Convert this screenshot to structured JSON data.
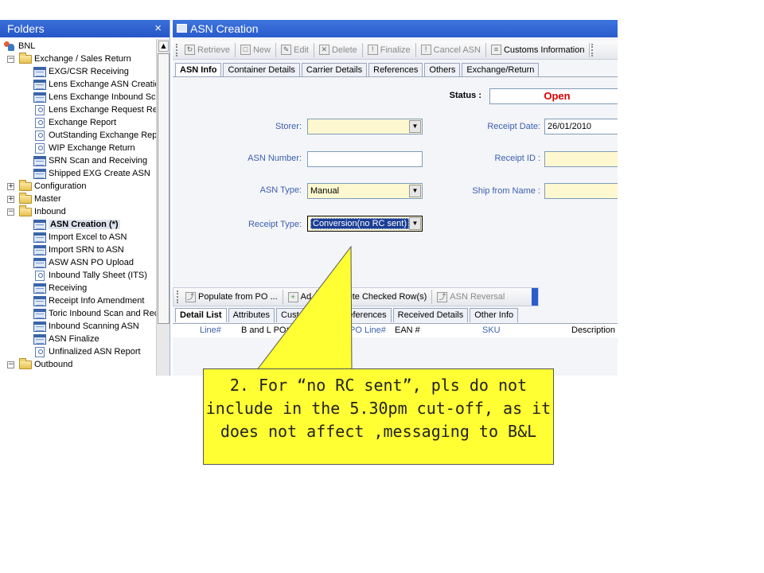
{
  "folders": {
    "title": "Folders",
    "close_glyph": "×",
    "items": [
      {
        "label": "BNL",
        "icon": "people-icon",
        "indent": 0,
        "expander": ""
      },
      {
        "label": "Exchange / Sales Return",
        "icon": "folder-icon",
        "indent": 1,
        "expander": "−"
      },
      {
        "label": "EXG/CSR Receiving",
        "icon": "screen-icon",
        "indent": 2,
        "expander": ""
      },
      {
        "label": "Lens Exchange ASN Creatic",
        "icon": "screen-icon",
        "indent": 2,
        "expander": ""
      },
      {
        "label": "Lens Exchange Inbound Sca",
        "icon": "screen-icon",
        "indent": 2,
        "expander": ""
      },
      {
        "label": "Lens Exchange Request Re",
        "icon": "report-icon",
        "indent": 2,
        "expander": ""
      },
      {
        "label": "Exchange Report",
        "icon": "report-icon",
        "indent": 2,
        "expander": ""
      },
      {
        "label": "OutStanding Exchange Rep",
        "icon": "report-icon",
        "indent": 2,
        "expander": ""
      },
      {
        "label": "WIP Exchange Return",
        "icon": "report-icon",
        "indent": 2,
        "expander": ""
      },
      {
        "label": "SRN Scan and Receiving",
        "icon": "screen-icon",
        "indent": 2,
        "expander": ""
      },
      {
        "label": "Shipped EXG Create ASN",
        "icon": "screen-icon",
        "indent": 2,
        "expander": ""
      },
      {
        "label": "Configuration",
        "icon": "folder-icon",
        "indent": 1,
        "expander": "+"
      },
      {
        "label": "Master",
        "icon": "folder-icon",
        "indent": 1,
        "expander": "+"
      },
      {
        "label": "Inbound",
        "icon": "folder-icon",
        "indent": 1,
        "expander": "−"
      },
      {
        "label": "ASN Creation (*)",
        "icon": "screen-icon",
        "indent": 2,
        "expander": "",
        "selected": true
      },
      {
        "label": "Import Excel to ASN",
        "icon": "screen-icon",
        "indent": 2,
        "expander": ""
      },
      {
        "label": "Import SRN to ASN",
        "icon": "screen-icon",
        "indent": 2,
        "expander": ""
      },
      {
        "label": "ASW ASN PO Upload",
        "icon": "screen-icon",
        "indent": 2,
        "expander": ""
      },
      {
        "label": "Inbound Tally Sheet (ITS)",
        "icon": "report-icon",
        "indent": 2,
        "expander": ""
      },
      {
        "label": "Receiving",
        "icon": "screen-icon",
        "indent": 2,
        "expander": ""
      },
      {
        "label": "Receipt Info Amendment",
        "icon": "screen-icon",
        "indent": 2,
        "expander": ""
      },
      {
        "label": "Toric Inbound Scan and Rec",
        "icon": "screen-icon",
        "indent": 2,
        "expander": ""
      },
      {
        "label": "Inbound Scanning ASN",
        "icon": "screen-icon",
        "indent": 2,
        "expander": ""
      },
      {
        "label": "ASN Finalize",
        "icon": "screen-icon",
        "indent": 2,
        "expander": ""
      },
      {
        "label": "Unfinalized ASN Report",
        "icon": "report-icon",
        "indent": 2,
        "expander": ""
      },
      {
        "label": "Outbound",
        "icon": "folder-icon",
        "indent": 1,
        "expander": "−"
      }
    ]
  },
  "window": {
    "title": "ASN Creation",
    "toolbar": [
      {
        "label": "Retrieve",
        "icon": "retrieve-icon",
        "active": false
      },
      {
        "label": "New",
        "icon": "new-icon",
        "active": false
      },
      {
        "label": "Edit",
        "icon": "edit-icon",
        "active": false
      },
      {
        "label": "Delete",
        "icon": "delete-icon",
        "active": false
      },
      {
        "label": "Finalize",
        "icon": "finalize-icon",
        "active": false
      },
      {
        "label": "Cancel ASN",
        "icon": "cancel-icon",
        "active": false
      },
      {
        "label": "Customs Information",
        "icon": "customs-icon",
        "active": true
      }
    ],
    "tabs": [
      "ASN Info",
      "Container Details",
      "Carrier Details",
      "References",
      "Others",
      "Exchange/Return"
    ],
    "form": {
      "status_label": "Status :",
      "status_value": "Open",
      "storer_label": "Storer:",
      "storer_value": "",
      "receipt_date_label": "Receipt Date:",
      "receipt_date_value": "26/01/2010",
      "asn_number_label": "ASN Number:",
      "asn_number_value": "",
      "receipt_id_label": "Receipt ID :",
      "receipt_id_value": "",
      "asn_type_label": "ASN Type:",
      "asn_type_value": "Manual",
      "ship_from_label": "Ship from Name :",
      "ship_from_value": "",
      "receipt_type_label": "Receipt Type:",
      "receipt_type_value": "Conversion(no RC sent)"
    },
    "detail_toolbar": [
      {
        "label": "Populate from PO ...",
        "icon": "populate-icon"
      },
      {
        "label": "Ad",
        "icon": "add-icon"
      },
      {
        "label": "Delete Checked Row(s)",
        "icon": "delete-rows-icon"
      },
      {
        "label": "ASN Reversal",
        "icon": "reversal-icon"
      }
    ],
    "detail_tabs": [
      "Detail List",
      "Attributes",
      "Cust",
      "Internal References",
      "Received Details",
      "Other Info"
    ],
    "columns": [
      "Line#",
      "B and L PO#",
      "PO Line#",
      "EAN #",
      "SKU",
      "Description"
    ]
  },
  "callout": {
    "text": "2. For “no RC sent”, pls do not include in the 5.30pm cut-off, as it does not affect ,messaging to B&L",
    "color": "#ffff33"
  }
}
